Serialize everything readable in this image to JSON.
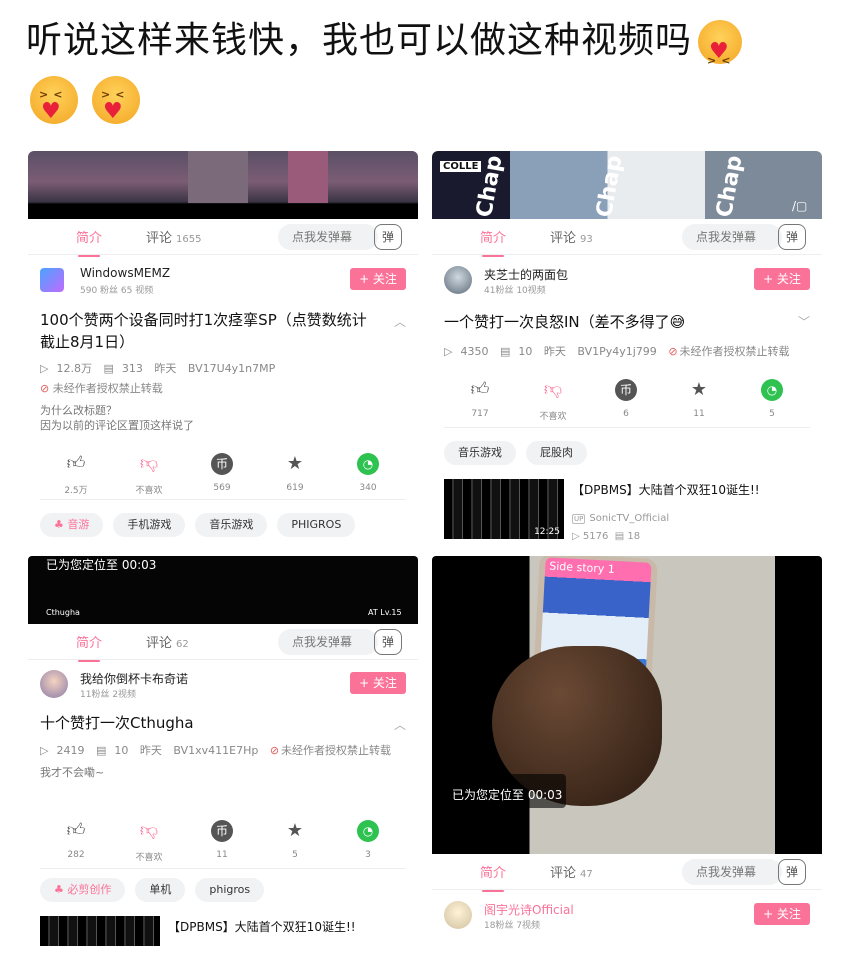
{
  "post": {
    "title": "听说这样来钱快，我也可以做这种视频吗"
  },
  "colors": {
    "accent": "#fb7299",
    "wechat": "#2ec251"
  },
  "panels": {
    "p1": {
      "tabs": {
        "intro": "简介",
        "comments": "评论",
        "comment_count": "1655"
      },
      "danmu_placeholder": "点我发弹幕",
      "danmu_btn": "弹",
      "up": {
        "name": "WindowsMEMZ",
        "sub": "590 粉丝   65 视频"
      },
      "follow": "+ 关注",
      "title": "100个赞两个设备同时打1次痉挛SP（点赞数统计截止8月1日）",
      "meta": {
        "views": "12.8万",
        "danmaku": "313",
        "date": "昨天",
        "bv": "BV17U4y1n7MP"
      },
      "ban": "未经作者授权禁止转载",
      "desc": [
        "为什么改标题？",
        "因为以前的评论区置顶这样说了"
      ],
      "actions": {
        "like": "2.5万",
        "dislike": "不喜欢",
        "coin": "569",
        "fav": "619",
        "share": "340"
      },
      "tags": [
        "音游",
        "手机游戏",
        "音乐游戏",
        "PHIGROS"
      ]
    },
    "p2": {
      "tabs": {
        "intro": "简介",
        "comments": "评论",
        "comment_count": "93"
      },
      "danmu_placeholder": "点我发弹幕",
      "danmu_btn": "弹",
      "video_text": [
        "COLLE",
        "Chap",
        "Chap",
        "Chap"
      ],
      "up": {
        "name": "夹芝士的两面包",
        "sub": "41粉丝   10视频"
      },
      "follow": "+ 关注",
      "title": "一个赞打一次良怒IN（差不多得了😅",
      "meta": {
        "views": "4350",
        "danmaku": "10",
        "date": "昨天",
        "bv": "BV1Py4y1j799",
        "ban": "未经作者授权禁止转载"
      },
      "actions": {
        "like": "717",
        "dislike": "不喜欢",
        "coin": "6",
        "fav": "11",
        "share": "5"
      },
      "tags": [
        "音乐游戏",
        "屁股肉"
      ],
      "rec": {
        "title": "【DPBMS】大陆首个双狂10诞生!!",
        "up": "SonicTV_Official",
        "views": "5176",
        "danmaku": "18",
        "time": "12:25"
      }
    },
    "p3": {
      "overlay": "已为您定位至 00:03",
      "video_small_left": "Cthugha",
      "video_small_right": "AT Lv.15",
      "tabs": {
        "intro": "简介",
        "comments": "评论",
        "comment_count": "62"
      },
      "danmu_placeholder": "点我发弹幕",
      "danmu_btn": "弹",
      "up": {
        "name": "我给你倒杯卡布奇诺",
        "sub": "11粉丝   2视频"
      },
      "follow": "+ 关注",
      "title": "十个赞打一次Cthugha",
      "meta": {
        "views": "2419",
        "danmaku": "10",
        "date": "昨天",
        "bv": "BV1xv411E7Hp",
        "ban": "未经作者授权禁止转载"
      },
      "desc": "我才不会嘞~",
      "actions": {
        "like": "282",
        "dislike": "不喜欢",
        "coin": "11",
        "fav": "5",
        "share": "3"
      },
      "tags": [
        "必剪创作",
        "单机",
        "phigros"
      ],
      "rec": {
        "title": "【DPBMS】大陆首个双狂10诞生!!"
      }
    },
    "p4": {
      "screen_text": "Side story 1",
      "overlay": "已为您定位至 00:03",
      "tabs": {
        "intro": "简介",
        "comments": "评论",
        "comment_count": "47"
      },
      "danmu_placeholder": "点我发弹幕",
      "danmu_btn": "弹",
      "up": {
        "name": "阁宇光诗Official",
        "sub": "18粉丝   7视频"
      },
      "follow": "+ 关注"
    }
  }
}
